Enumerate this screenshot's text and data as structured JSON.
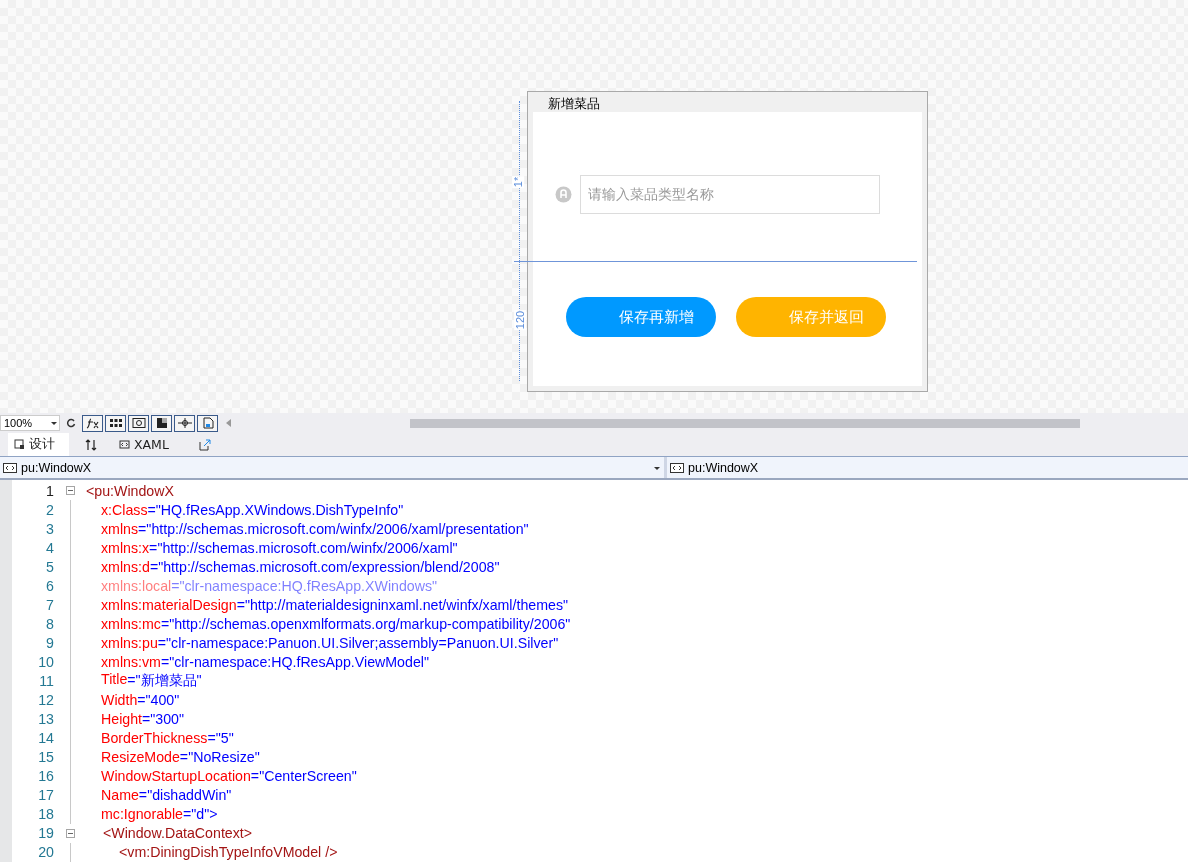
{
  "designer": {
    "window_title": "新增菜品",
    "row_labels": [
      "1*",
      "120"
    ],
    "field": {
      "placeholder": "请输入菜品类型名称"
    },
    "buttons": [
      {
        "label": "保存再新增",
        "color": "#0099ff"
      },
      {
        "label": "保存并返回",
        "color": "#ffb400"
      }
    ]
  },
  "toolbar": {
    "zoom": "100%"
  },
  "tabs": [
    {
      "label": "设计",
      "selected": true
    },
    {
      "label": "XAML",
      "selected": false
    }
  ],
  "element_selectors": [
    "pu:WindowX",
    "pu:WindowX"
  ],
  "code_lines": [
    {
      "number": "1",
      "kind": "root-tag",
      "text": "<pu:WindowX",
      "dimmed": false,
      "foldable": true
    },
    {
      "number": "2",
      "kind": "attribute",
      "name": "x:Class",
      "value": "=\"HQ.fResApp.XWindows.DishTypeInfo\"",
      "dimmed": false,
      "foldable": false
    },
    {
      "number": "3",
      "kind": "attribute",
      "name": "xmlns",
      "value": "=\"http://schemas.microsoft.com/winfx/2006/xaml/presentation\"",
      "dimmed": false,
      "foldable": false
    },
    {
      "number": "4",
      "kind": "attribute",
      "name": "xmlns:x",
      "value": "=\"http://schemas.microsoft.com/winfx/2006/xaml\"",
      "dimmed": false,
      "foldable": false
    },
    {
      "number": "5",
      "kind": "attribute",
      "name": "xmlns:d",
      "value": "=\"http://schemas.microsoft.com/expression/blend/2008\"",
      "dimmed": false,
      "foldable": false
    },
    {
      "number": "6",
      "kind": "attribute",
      "name": "xmlns:local",
      "value": "=\"clr-namespace:HQ.fResApp.XWindows\"",
      "dimmed": true,
      "foldable": false
    },
    {
      "number": "7",
      "kind": "attribute",
      "name": "xmlns:materialDesign",
      "value": "=\"http://materialdesigninxaml.net/winfx/xaml/themes\"",
      "dimmed": false,
      "foldable": false
    },
    {
      "number": "8",
      "kind": "attribute",
      "name": "xmlns:mc",
      "value": "=\"http://schemas.openxmlformats.org/markup-compatibility/2006\"",
      "dimmed": false,
      "foldable": false
    },
    {
      "number": "9",
      "kind": "attribute",
      "name": "xmlns:pu",
      "value": "=\"clr-namespace:Panuon.UI.Silver;assembly=Panuon.UI.Silver\"",
      "dimmed": false,
      "foldable": false
    },
    {
      "number": "10",
      "kind": "attribute",
      "name": "xmlns:vm",
      "value": "=\"clr-namespace:HQ.fResApp.ViewModel\"",
      "dimmed": false,
      "foldable": false
    },
    {
      "number": "11",
      "kind": "attribute",
      "name": "Title",
      "value": "=\"新增菜品\"",
      "dimmed": false,
      "foldable": false
    },
    {
      "number": "12",
      "kind": "attribute",
      "name": "Width",
      "value": "=\"400\"",
      "dimmed": false,
      "foldable": false
    },
    {
      "number": "13",
      "kind": "attribute",
      "name": "Height",
      "value": "=\"300\"",
      "dimmed": false,
      "foldable": false
    },
    {
      "number": "14",
      "kind": "attribute",
      "name": "BorderThickness",
      "value": "=\"5\"",
      "dimmed": false,
      "foldable": false
    },
    {
      "number": "15",
      "kind": "attribute",
      "name": "ResizeMode",
      "value": "=\"NoResize\"",
      "dimmed": false,
      "foldable": false
    },
    {
      "number": "16",
      "kind": "attribute",
      "name": "WindowStartupLocation",
      "value": "=\"CenterScreen\"",
      "dimmed": false,
      "foldable": false
    },
    {
      "number": "17",
      "kind": "attribute",
      "name": "Name",
      "value": "=\"dishaddWin\"",
      "dimmed": false,
      "foldable": false
    },
    {
      "number": "18",
      "kind": "attribute",
      "name": "mc:Ignorable",
      "value": "=\"d\">",
      "dimmed": false,
      "foldable": false
    },
    {
      "number": "19",
      "kind": "child-tag",
      "text": "<Window.DataContext>",
      "dimmed": false,
      "foldable": true
    },
    {
      "number": "20",
      "kind": "grandchild-tag",
      "text": "<vm:DiningDishTypeInfoVModel />",
      "dimmed": false,
      "foldable": false
    }
  ]
}
